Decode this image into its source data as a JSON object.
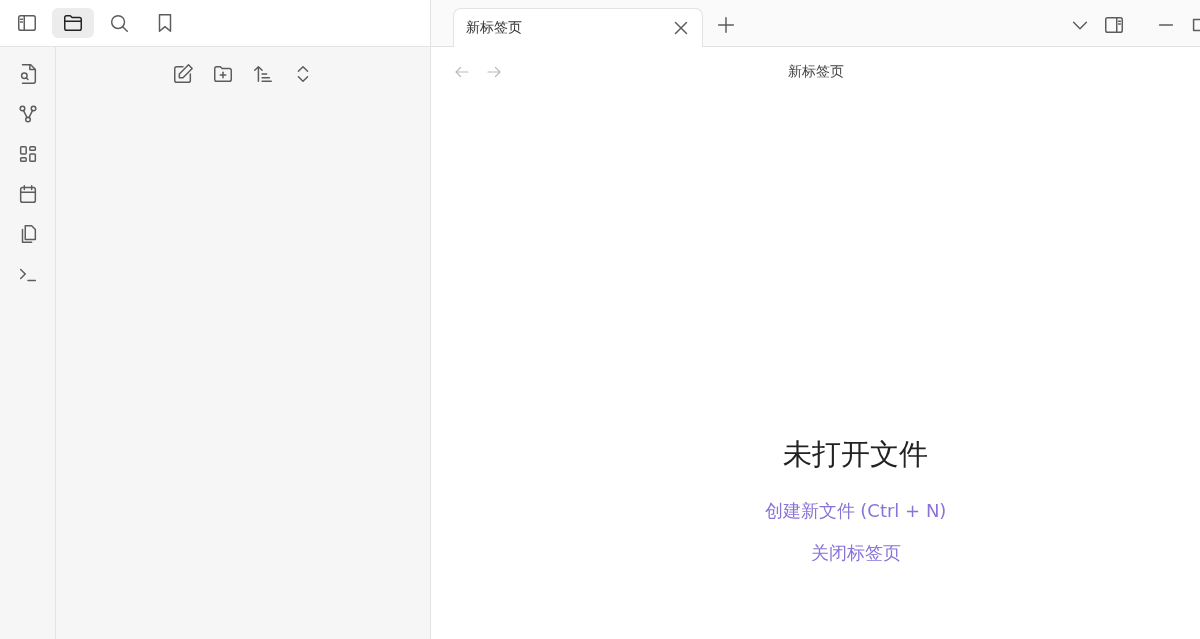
{
  "sidebar_tabs": [
    {
      "kind": "files",
      "selected": true
    },
    {
      "kind": "search",
      "selected": false
    },
    {
      "kind": "bookmarks",
      "selected": false
    }
  ],
  "tabs": [
    {
      "label": "新标签页",
      "selected": true
    }
  ],
  "view": {
    "title": "新标签页"
  },
  "empty_state": {
    "heading": "未打开文件",
    "actions": [
      "创建新文件 (Ctrl + N)",
      "关闭标签页"
    ]
  }
}
